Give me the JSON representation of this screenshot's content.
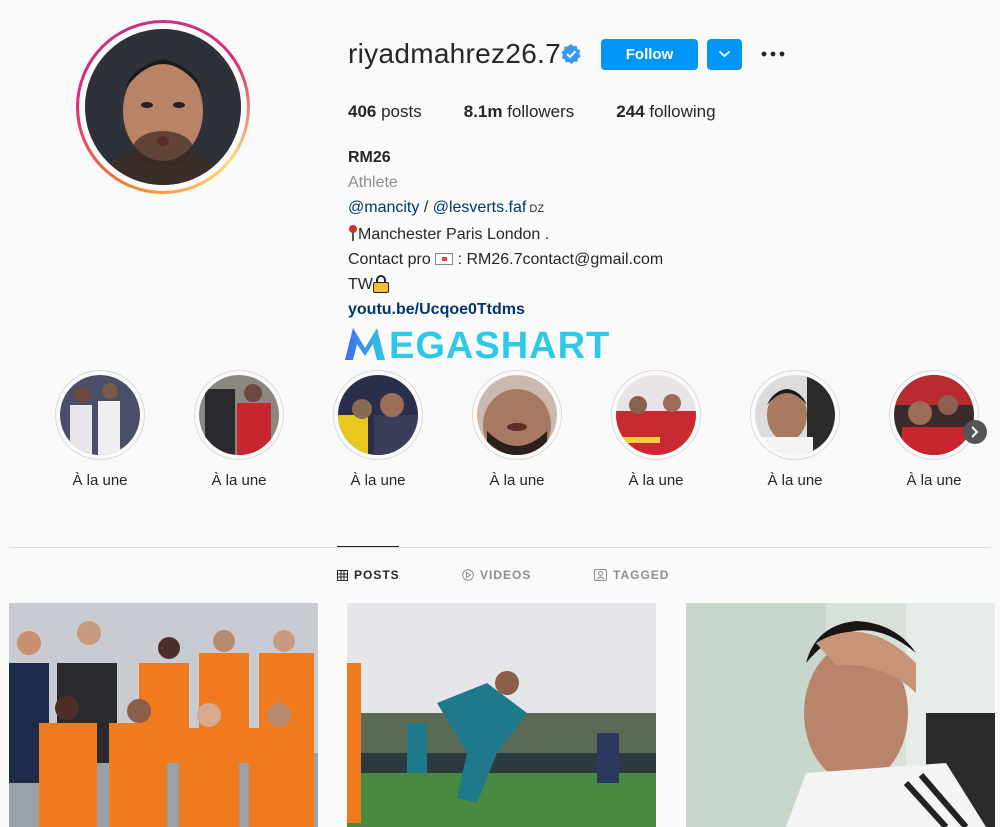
{
  "profile": {
    "username": "riyadmahrez26.7",
    "follow_label": "Follow",
    "stats": {
      "posts_count": "406",
      "posts_label": " posts",
      "followers_count": "8.1m",
      "followers_label": " followers",
      "following_count": "244",
      "following_label": " following"
    },
    "bio": {
      "name": "RM26",
      "category": "Athlete",
      "mention1": "@mancity",
      "sep": " / ",
      "mention2": "@lesverts.faf",
      "flag": " DZ",
      "location": "Manchester Paris London .",
      "contact_prefix": "Contact pro ",
      "contact_email": " : RM26.7contact@gmail.com",
      "tw": "TW",
      "link": "youtu.be/Ucqoe0Ttdms"
    }
  },
  "watermark": {
    "text": "EGASHART",
    "logo_letter": "M"
  },
  "highlights": [
    {
      "label": "À la une"
    },
    {
      "label": "À la une"
    },
    {
      "label": "À la une"
    },
    {
      "label": "À la une"
    },
    {
      "label": "À la une"
    },
    {
      "label": "À la une"
    },
    {
      "label": "À la une"
    }
  ],
  "tabs": {
    "posts": "POSTS",
    "videos": "VIDEOS",
    "tagged": "TAGGED"
  },
  "colors": {
    "accent": "#0095f6",
    "link": "#00376b",
    "muted": "#8e8e8e"
  }
}
